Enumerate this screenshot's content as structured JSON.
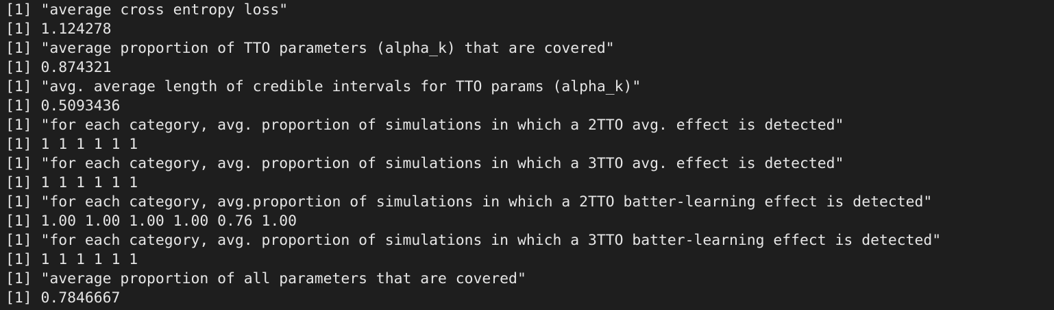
{
  "terminal": {
    "lines": [
      "[1] \"average cross entropy loss\"",
      "[1] 1.124278",
      "[1] \"average proportion of TTO parameters (alpha_k) that are covered\"",
      "[1] 0.874321",
      "[1] \"avg. average length of credible intervals for TTO params (alpha_k)\"",
      "[1] 0.5093436",
      "[1] \"for each category, avg. proportion of simulations in which a 2TTO avg. effect is detected\"",
      "[1] 1 1 1 1 1 1",
      "[1] \"for each category, avg. proportion of simulations in which a 3TTO avg. effect is detected\"",
      "[1] 1 1 1 1 1 1",
      "[1] \"for each category, avg.proportion of simulations in which a 2TTO batter-learning effect is detected\"",
      "[1] 1.00 1.00 1.00 1.00 0.76 1.00",
      "[1] \"for each category, avg. proportion of simulations in which a 3TTO batter-learning effect is detected\"",
      "[1] 1 1 1 1 1 1",
      "[1] \"average proportion of all parameters that are covered\"",
      "[1] 0.7846667"
    ]
  }
}
